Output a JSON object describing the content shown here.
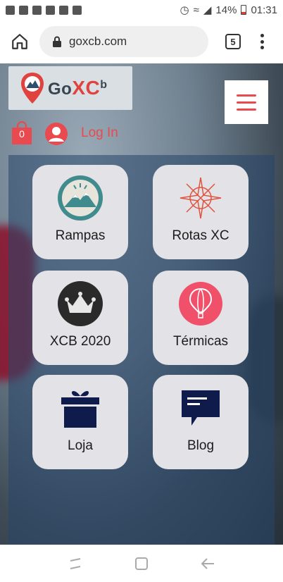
{
  "status_bar": {
    "battery": "14%",
    "time": "01:31"
  },
  "browser": {
    "url": "goxcb.com",
    "tab_count": "5"
  },
  "site": {
    "logo": {
      "go": "Go",
      "xc": "XC",
      "b": "b"
    },
    "cart_count": "0",
    "login_label": "Log In"
  },
  "tiles": [
    {
      "label": "Rampas",
      "icon": "mountain-icon"
    },
    {
      "label": "Rotas XC",
      "icon": "compass-rose-icon"
    },
    {
      "label": "XCB 2020",
      "icon": "crown-icon"
    },
    {
      "label": "Térmicas",
      "icon": "hot-air-balloon-icon"
    },
    {
      "label": "Loja",
      "icon": "gift-icon"
    },
    {
      "label": "Blog",
      "icon": "chat-bubble-icon"
    }
  ],
  "colors": {
    "accent": "#e84a4f",
    "tile_bg": "#e3e2e6",
    "navy": "#0f1b4a",
    "teal": "#3f8b8d"
  }
}
